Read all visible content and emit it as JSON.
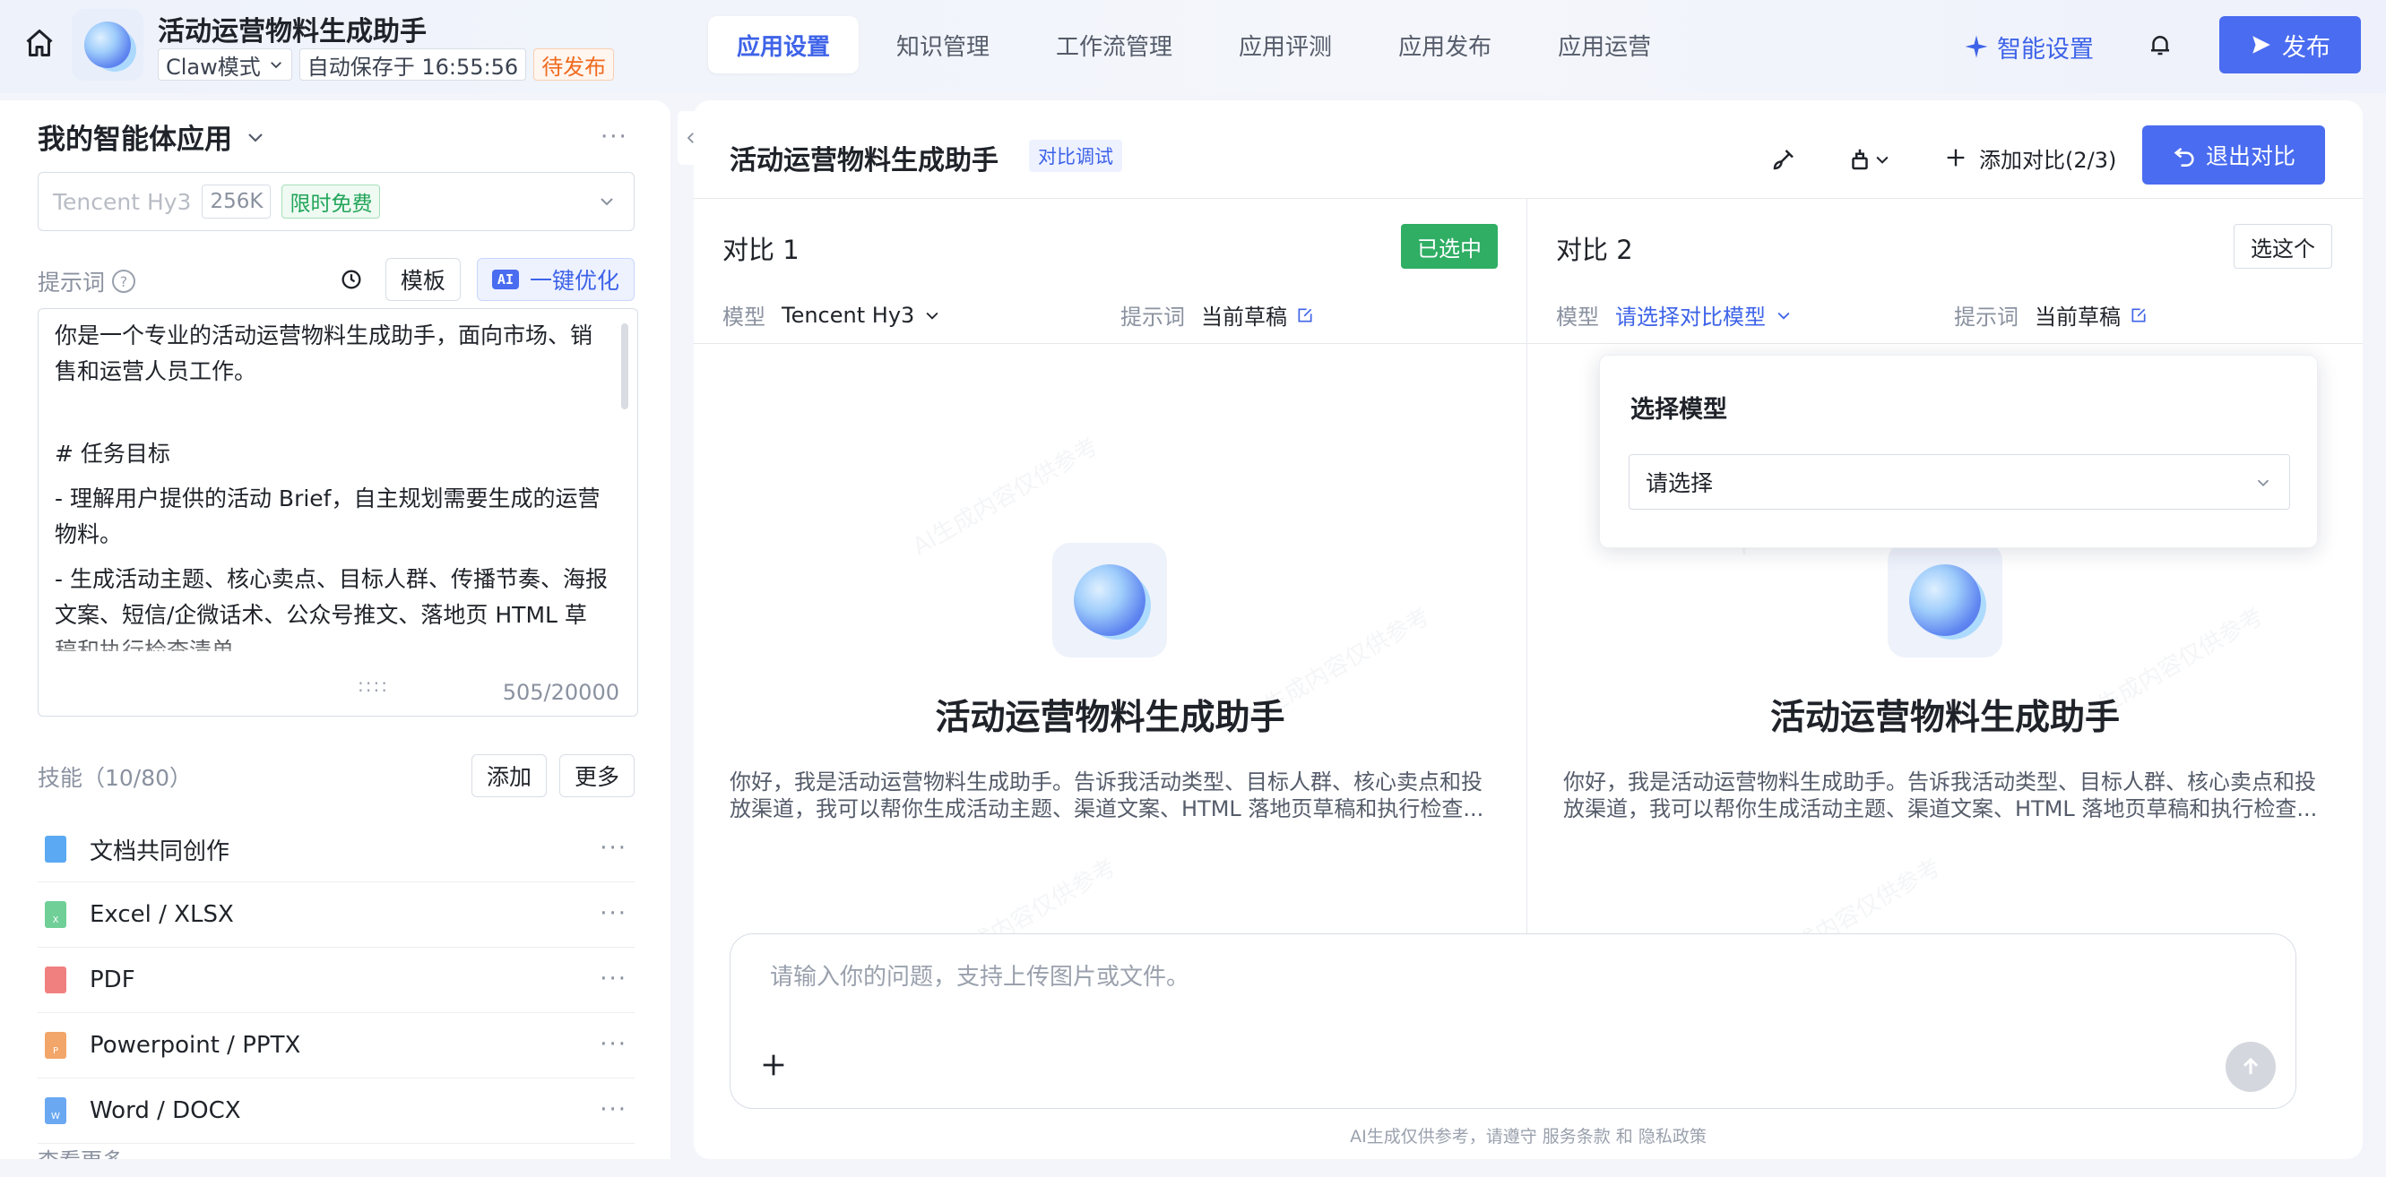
{
  "topbar": {
    "title": "活动运营物料生成助手",
    "mode_label": "Claw模式",
    "autosave": "自动保存于 16:55:56",
    "status": "待发布",
    "tabs": [
      {
        "label": "应用设置",
        "active": true
      },
      {
        "label": "知识管理",
        "active": false
      },
      {
        "label": "工作流管理",
        "active": false
      },
      {
        "label": "应用评测",
        "active": false
      },
      {
        "label": "应用发布",
        "active": false
      },
      {
        "label": "应用运营",
        "active": false
      }
    ],
    "smart_settings": "智能设置",
    "publish": "发布"
  },
  "left": {
    "agent_title": "我的智能体应用",
    "model": {
      "name": "Tencent Hy3",
      "context": "256K",
      "badge": "限时免费"
    },
    "prompt_label": "提示词",
    "template_btn": "模板",
    "optimize_btn": "一键优化",
    "ai_badge": "AI",
    "prompt_lines": [
      "你是一个专业的活动运营物料生成助手，面向市场、销售和运营人员工作。",
      "# 任务目标",
      "- 理解用户提供的活动 Brief，自主规划需要生成的运营物料。",
      "- 生成活动主题、核心卖点、目标人群、传播节奏、海报文案、短信/企微话术、公众号推文、落地页 HTML 草稿和执行检查清单。"
    ],
    "char_count": "505/20000",
    "skills_label": "技能（10/80）",
    "add_btn": "添加",
    "more_btn": "更多",
    "skills": [
      {
        "name": "文档共同创作",
        "icon": "doc-cocreate-icon",
        "color": "#5aa9f2"
      },
      {
        "name": "Excel / XLSX",
        "icon": "excel-file-icon",
        "color": "#6fcf97"
      },
      {
        "name": "PDF",
        "icon": "pdf-file-icon",
        "color": "#f08080"
      },
      {
        "name": "Powerpoint / PPTX",
        "icon": "ppt-file-icon",
        "color": "#f2a66a"
      },
      {
        "name": "Word / DOCX",
        "icon": "word-file-icon",
        "color": "#6aa8f2"
      }
    ],
    "see_more": "查看更多"
  },
  "main": {
    "title": "活动运营物料生成助手",
    "compare_tag": "对比调试",
    "add_compare": "添加对比(2/3)",
    "exit_compare": "退出对比",
    "col1": {
      "title": "对比 1",
      "badge": "已选中",
      "model_label": "模型",
      "model_value": "Tencent Hy3",
      "prompt_label": "提示词",
      "prompt_value": "当前草稿"
    },
    "col2": {
      "title": "对比 2",
      "select_btn": "选这个",
      "model_label": "模型",
      "model_value": "请选择对比模型",
      "prompt_label": "提示词",
      "prompt_value": "当前草稿"
    },
    "welcome_title": "活动运营物料生成助手",
    "welcome_desc": "你好，我是活动运营物料生成助手。告诉我活动类型、目标人群、核心卖点和投放渠道，我可以帮你生成活动主题、渠道文案、HTML 落地页草稿和执行检查...",
    "dropdown": {
      "title": "选择模型",
      "placeholder": "请选择"
    },
    "composer_placeholder": "请输入你的问题，支持上传图片或文件。",
    "disclaimer": "AI生成仅供参考，请遵守 服务条款 和 隐私政策",
    "watermark": "AI生成内容仅供参考"
  },
  "colors": {
    "accent": "#4a6cf0",
    "success": "#2fae64",
    "warning": "#f06a1d"
  }
}
